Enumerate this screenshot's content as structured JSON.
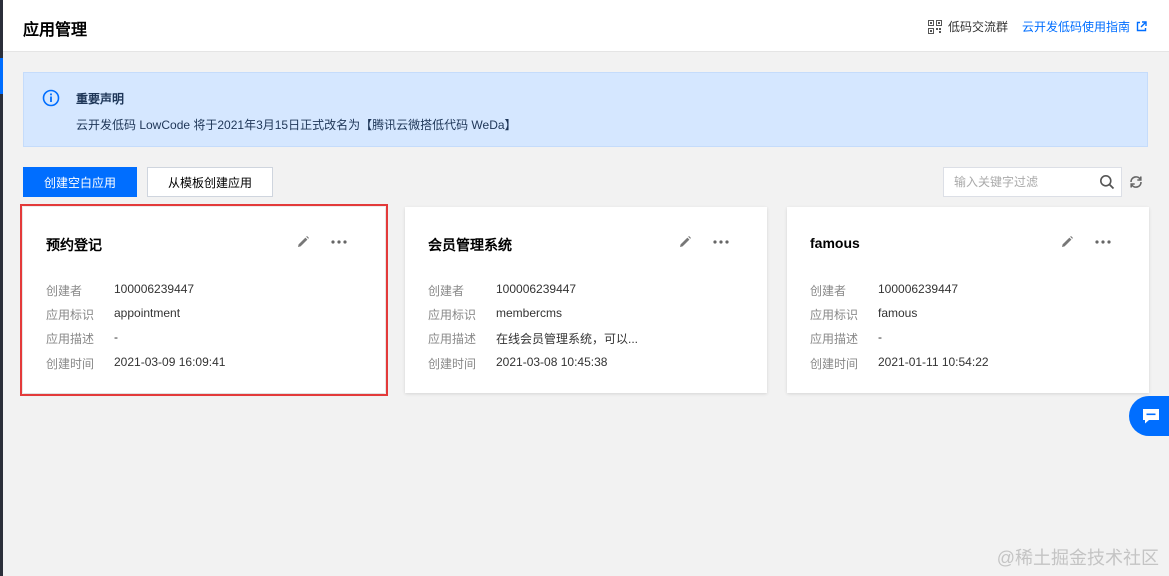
{
  "header": {
    "title": "应用管理",
    "group_link": "低码交流群",
    "guide_link": "云开发低码使用指南"
  },
  "notice": {
    "title": "重要声明",
    "text": "云开发低码 LowCode 将于2021年3月15日正式改名为【腾讯云微搭低代码 WeDa】"
  },
  "toolbar": {
    "create_blank": "创建空白应用",
    "create_from_template": "从模板创建应用",
    "search_placeholder": "输入关键字过滤"
  },
  "labels": {
    "creator": "创建者",
    "app_id": "应用标识",
    "app_desc": "应用描述",
    "created_time": "创建时间"
  },
  "apps": [
    {
      "name": "预约登记",
      "creator": "100006239447",
      "app_id": "appointment",
      "desc": "-",
      "created": "2021-03-09 16:09:41"
    },
    {
      "name": "会员管理系统",
      "creator": "100006239447",
      "app_id": "membercms",
      "desc": "在线会员管理系统，可以...",
      "created": "2021-03-08 10:45:38"
    },
    {
      "name": "famous",
      "creator": "100006239447",
      "app_id": "famous",
      "desc": "-",
      "created": "2021-01-11 10:54:22"
    }
  ],
  "watermark": "@稀土掘金技术社区",
  "colors": {
    "primary": "#006eff",
    "notice_bg": "#d5e7ff",
    "highlight": "#e33a3a",
    "page_bg": "#f2f2f2"
  },
  "icons": [
    "qrcode-icon",
    "external-link-icon",
    "info-icon",
    "search-icon",
    "refresh-icon",
    "edit-icon",
    "more-icon",
    "chat-icon"
  ]
}
